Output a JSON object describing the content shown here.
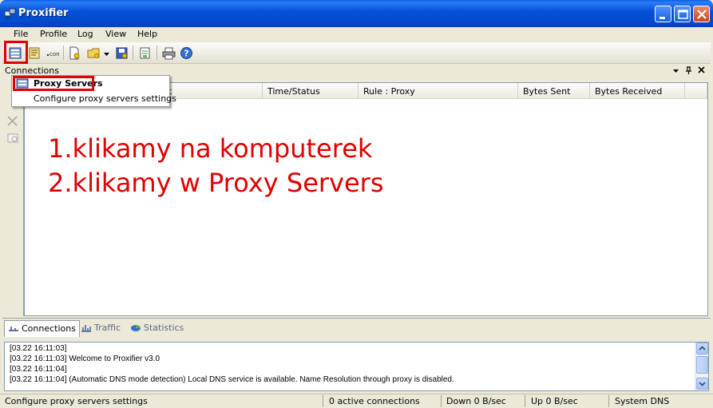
{
  "window": {
    "title": "Proxifier"
  },
  "menu": [
    "File",
    "Profile",
    "Log",
    "View",
    "Help"
  ],
  "toolbar": {
    "icons": [
      "proxy-servers-icon",
      "proxification-rules-icon",
      "name-resolution-icon",
      "new-profile-icon",
      "open-profile-icon",
      "dropdown-icon",
      "save-profile-icon",
      "advanced-icon",
      "print-icon",
      "help-icon"
    ]
  },
  "panel": {
    "title": "Connections"
  },
  "columns": [
    "Application / Target",
    "Time/Status",
    "Rule : Proxy",
    "Bytes Sent",
    "Bytes Received"
  ],
  "column_visible": [
    "t",
    "Time/Status",
    "Rule : Proxy",
    "Bytes Sent",
    "Bytes Received"
  ],
  "popup": {
    "title": "Proxy Servers",
    "description": "Configure proxy servers settings"
  },
  "annotation": {
    "line1": "1.klikamy na komputerek",
    "line2": "2.klikamy w Proxy Servers"
  },
  "tabs": [
    {
      "label": "Connections",
      "active": true
    },
    {
      "label": "Traffic",
      "active": false
    },
    {
      "label": "Statistics",
      "active": false
    }
  ],
  "log": [
    "[03.22 16:11:03]",
    "[03.22 16:11:03]     Welcome to Proxifier v3.0",
    "[03.22 16:11:04]",
    "[03.22 16:11:04] (Automatic DNS mode detection) Local DNS service is available. Name Resolution through proxy is disabled."
  ],
  "status": {
    "hint": "Configure proxy servers settings",
    "connections": "0 active connections",
    "down": "Down 0 B/sec",
    "up": "Up 0 B/sec",
    "dns": "System DNS"
  },
  "colors": {
    "title_bar": "#0653d9",
    "annotation_red": "#e00000",
    "menu_bg": "#ece9d8"
  }
}
